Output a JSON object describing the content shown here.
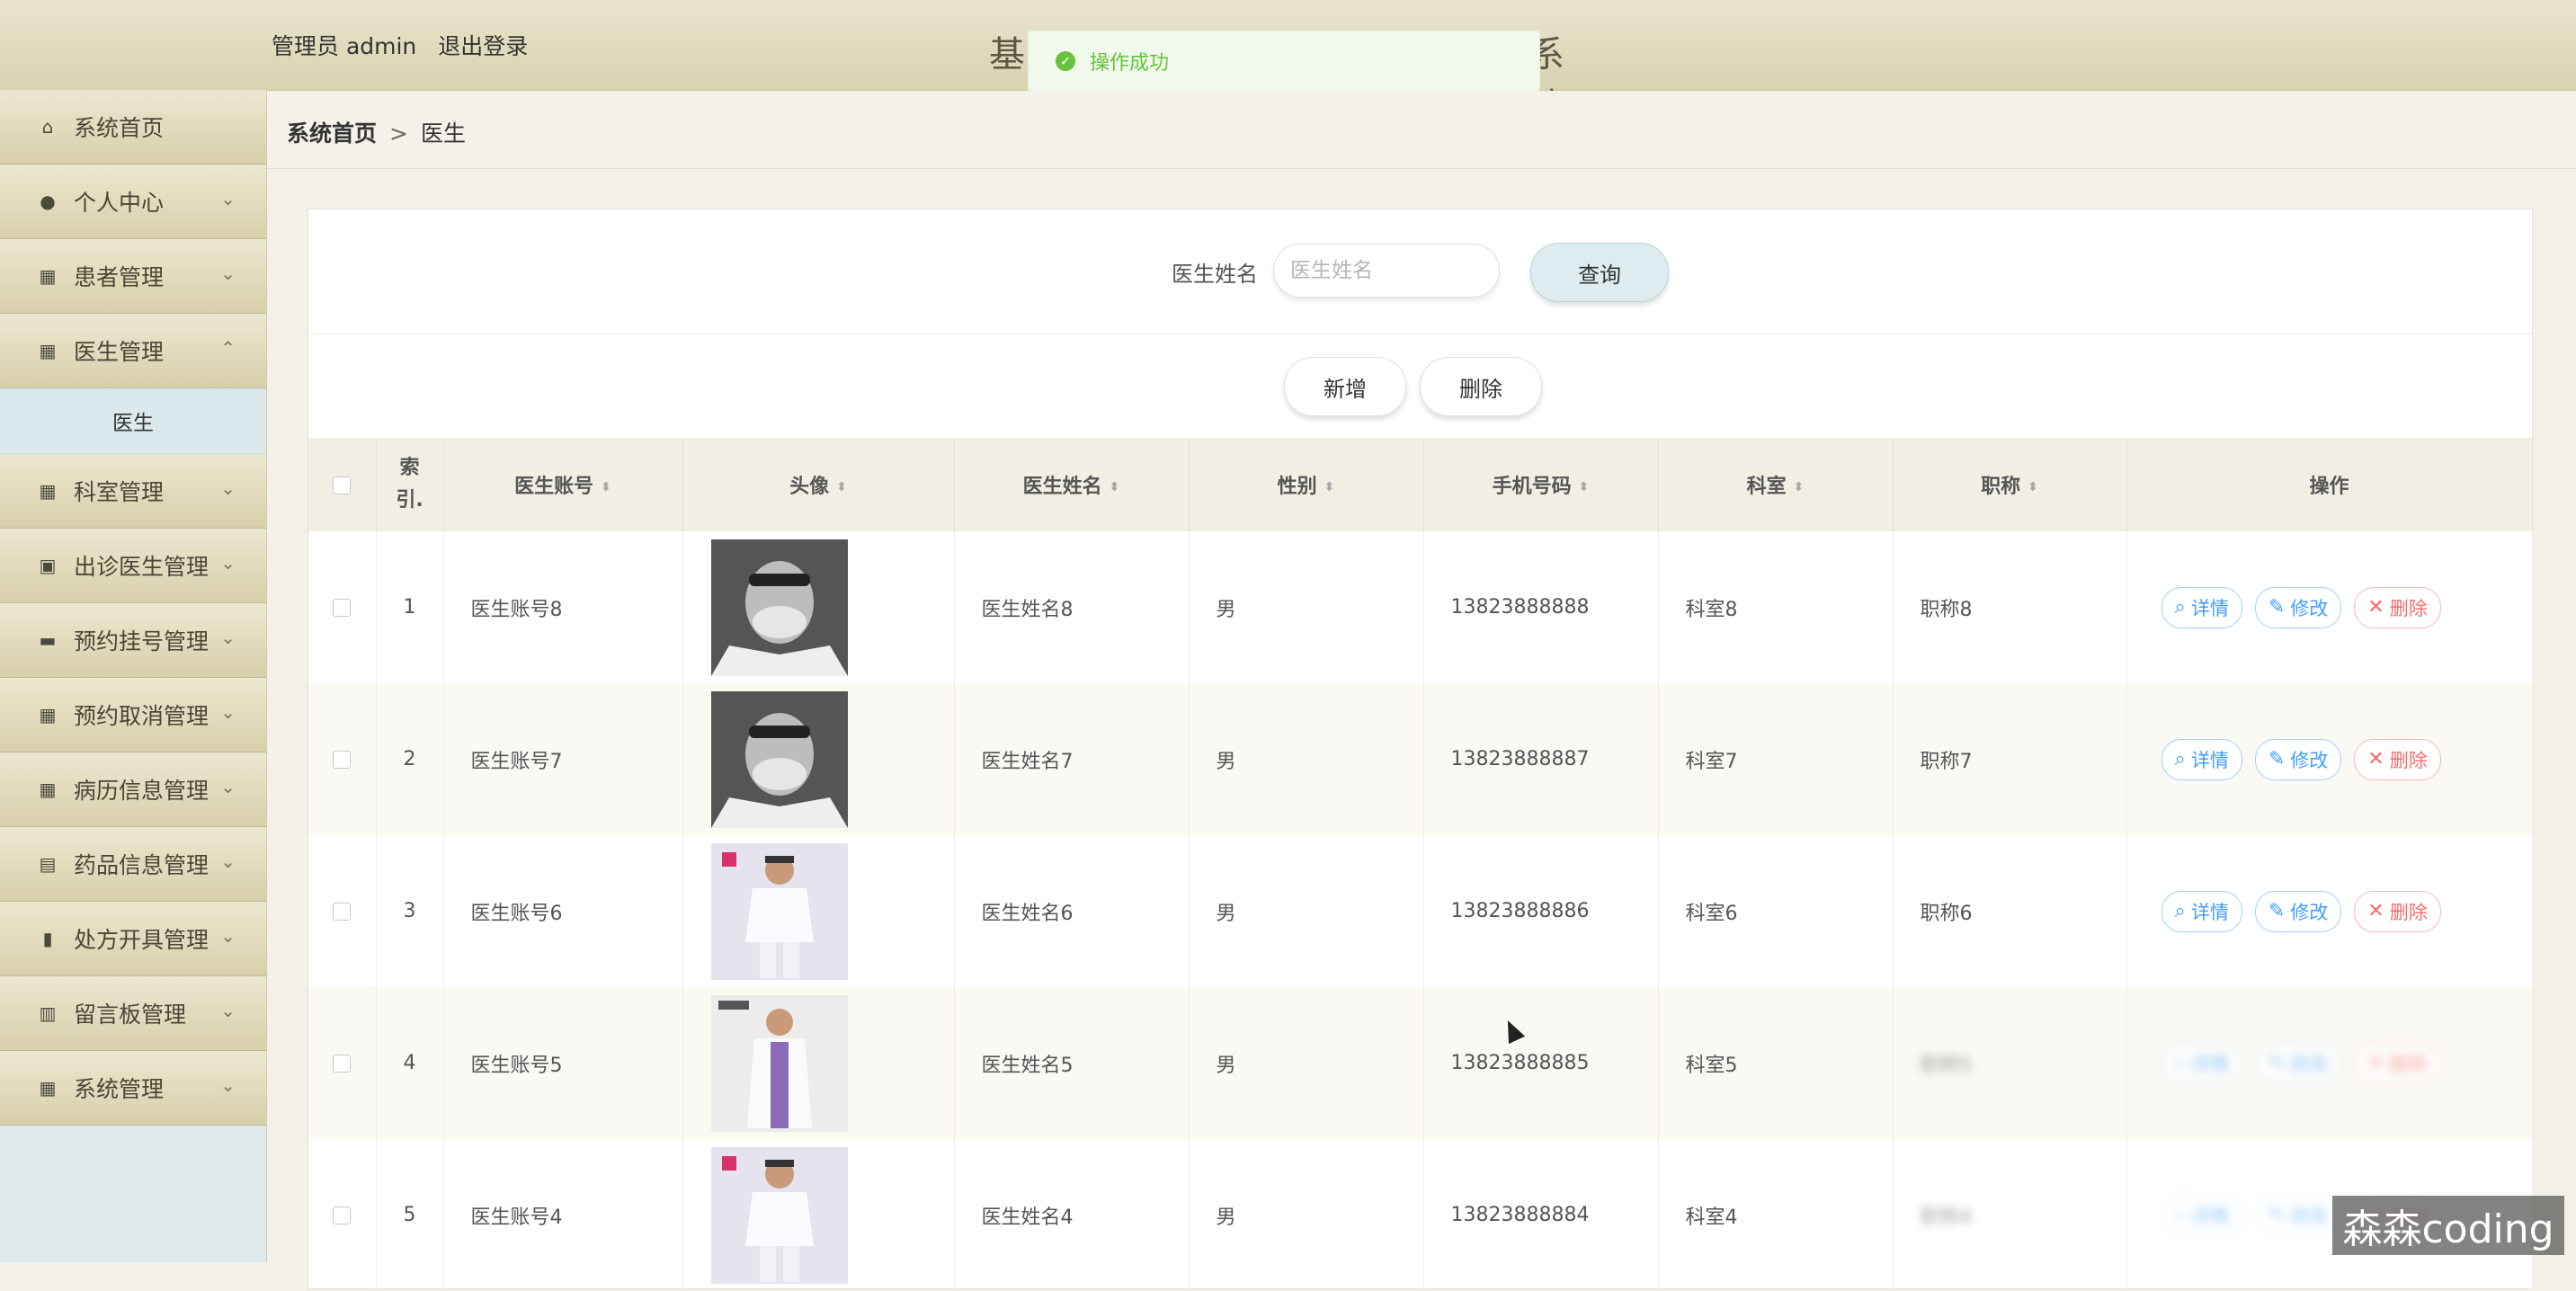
{
  "header": {
    "user_role": "管理员 admin",
    "logout_label": "退出登录",
    "app_title_start": "基",
    "app_title_end": "系统"
  },
  "toast": {
    "message": "操作成功"
  },
  "sidebar": {
    "items": [
      {
        "label": "系统首页",
        "icon": "home-icon"
      },
      {
        "label": "个人中心",
        "icon": "user-icon"
      },
      {
        "label": "患者管理",
        "icon": "grid-icon"
      },
      {
        "label": "医生管理",
        "icon": "grid-icon"
      },
      {
        "label": "科室管理",
        "icon": "grid-icon"
      },
      {
        "label": "出诊医生管理",
        "icon": "briefcase-icon"
      },
      {
        "label": "预约挂号管理",
        "icon": "monitor-icon"
      },
      {
        "label": "预约取消管理",
        "icon": "grid-icon"
      },
      {
        "label": "病历信息管理",
        "icon": "grid-icon"
      },
      {
        "label": "药品信息管理",
        "icon": "clipboard-icon"
      },
      {
        "label": "处方开具管理",
        "icon": "stamp-icon"
      },
      {
        "label": "留言板管理",
        "icon": "calendar-icon"
      },
      {
        "label": "系统管理",
        "icon": "grid9-icon"
      }
    ],
    "submenu_doctor": "医生"
  },
  "breadcrumb": {
    "home": "系统首页",
    "separator": ">",
    "current": "医生"
  },
  "search": {
    "label": "医生姓名",
    "placeholder": "医生姓名",
    "query_button": "查询"
  },
  "actions": {
    "add_label": "新增",
    "delete_label": "删除"
  },
  "table": {
    "headers": [
      "索\n引.",
      "医生账号",
      "头像",
      "医生姓名",
      "性别",
      "手机号码",
      "科室",
      "职称",
      "操作"
    ],
    "rows": [
      {
        "index": "1",
        "account": "医生账号8",
        "avatar": "doctor-mask-photo",
        "name": "医生姓名8",
        "gender": "男",
        "phone": "13823888888",
        "dept": "科室8",
        "title": "职称8"
      },
      {
        "index": "2",
        "account": "医生账号7",
        "avatar": "doctor-mask-photo",
        "name": "医生姓名7",
        "gender": "男",
        "phone": "13823888887",
        "dept": "科室7",
        "title": "职称7"
      },
      {
        "index": "3",
        "account": "医生账号6",
        "avatar": "doctor-whitecoat-photo",
        "name": "医生姓名6",
        "gender": "男",
        "phone": "13823888886",
        "dept": "科室6",
        "title": "职称6"
      },
      {
        "index": "4",
        "account": "医生账号5",
        "avatar": "doctor-purple-photo",
        "name": "医生姓名5",
        "gender": "男",
        "phone": "13823888885",
        "dept": "科室5",
        "title": "职称5"
      },
      {
        "index": "5",
        "account": "医生账号4",
        "avatar": "doctor-whitecoat-photo",
        "name": "医生姓名4",
        "gender": "男",
        "phone": "13823888884",
        "dept": "科室4",
        "title": "职称4"
      }
    ],
    "op_detail": "详情",
    "op_edit": "修改",
    "op_delete": "删除"
  },
  "watermark": "森森coding"
}
